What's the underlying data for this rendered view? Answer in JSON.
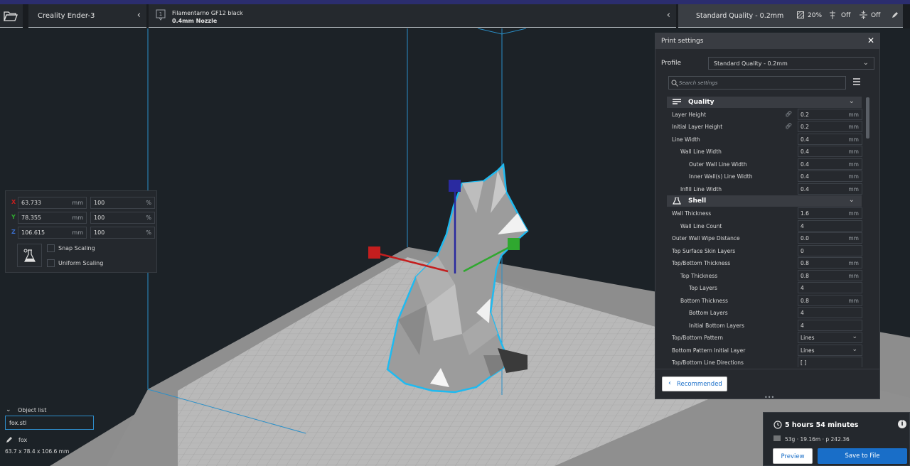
{
  "colors": {
    "accent": "#196ec8",
    "header_stripe": "#2b2d6e",
    "axis_x": "#c41e1e",
    "axis_y": "#2fa82f",
    "axis_z": "#2a2aa0",
    "selection_outline": "#1fbaf0"
  },
  "topbar": {
    "folder_icon": "folder-open-icon",
    "printer_name": "Creality Ender-3",
    "material_name": "Filamentarno GF12 black",
    "nozzle": "0.4mm Nozzle",
    "quality_name": "Standard Quality - 0.2mm",
    "infill": "20%",
    "support": "Off",
    "adhesion": "Off"
  },
  "transform": {
    "x": {
      "label": "X",
      "value": "63.733",
      "unit": "mm",
      "percent": "100",
      "pct_unit": "%"
    },
    "y": {
      "label": "Y",
      "value": "78.355",
      "unit": "mm",
      "percent": "100",
      "pct_unit": "%"
    },
    "z": {
      "label": "Z",
      "value": "106.615",
      "unit": "mm",
      "percent": "100",
      "pct_unit": "%"
    },
    "snap_scaling": "Snap Scaling",
    "uniform_scaling": "Uniform Scaling"
  },
  "object_list": {
    "title": "Object list",
    "file_name": "fox.stl",
    "object_name": "fox",
    "dimensions": "63.7 x 78.4 x 106.6 mm"
  },
  "print_settings": {
    "title": "Print settings",
    "profile_label": "Profile",
    "profile_value": "Standard Quality - 0.2mm",
    "search_placeholder": "Search settings",
    "recommended_label": "Recommended",
    "categories": {
      "quality": "Quality",
      "shell": "Shell"
    },
    "quality_rows": [
      {
        "label": "Layer Height",
        "value": "0.2",
        "unit": "mm"
      },
      {
        "label": "Initial Layer Height",
        "value": "0.2",
        "unit": "mm"
      },
      {
        "label": "Line Width",
        "value": "0.4",
        "unit": "mm"
      },
      {
        "label": "Wall Line Width",
        "value": "0.4",
        "unit": "mm"
      },
      {
        "label": "Outer Wall Line Width",
        "value": "0.4",
        "unit": "mm"
      },
      {
        "label": "Inner Wall(s) Line Width",
        "value": "0.4",
        "unit": "mm"
      },
      {
        "label": "Infill Line Width",
        "value": "0.4",
        "unit": "mm"
      }
    ],
    "shell_rows": [
      {
        "label": "Wall Thickness",
        "value": "1.6",
        "unit": "mm"
      },
      {
        "label": "Wall Line Count",
        "value": "4",
        "unit": ""
      },
      {
        "label": "Outer Wall Wipe Distance",
        "value": "0.0",
        "unit": "mm"
      },
      {
        "label": "Top Surface Skin Layers",
        "value": "0",
        "unit": ""
      },
      {
        "label": "Top/Bottom Thickness",
        "value": "0.8",
        "unit": "mm"
      },
      {
        "label": "Top Thickness",
        "value": "0.8",
        "unit": "mm"
      },
      {
        "label": "Top Layers",
        "value": "4",
        "unit": ""
      },
      {
        "label": "Bottom Thickness",
        "value": "0.8",
        "unit": "mm"
      },
      {
        "label": "Bottom Layers",
        "value": "4",
        "unit": ""
      },
      {
        "label": "Initial Bottom Layers",
        "value": "4",
        "unit": ""
      },
      {
        "label": "Top/Bottom Pattern",
        "value": "Lines",
        "unit": ""
      },
      {
        "label": "Bottom Pattern Initial Layer",
        "value": "Lines",
        "unit": ""
      },
      {
        "label": "Top/Bottom Line Directions",
        "value": "[ ]",
        "unit": ""
      }
    ]
  },
  "estimate": {
    "time": "5 hours 54 minutes",
    "detail": "53g · 19.16m · p 242.36",
    "preview_label": "Preview",
    "save_label": "Save to File"
  }
}
